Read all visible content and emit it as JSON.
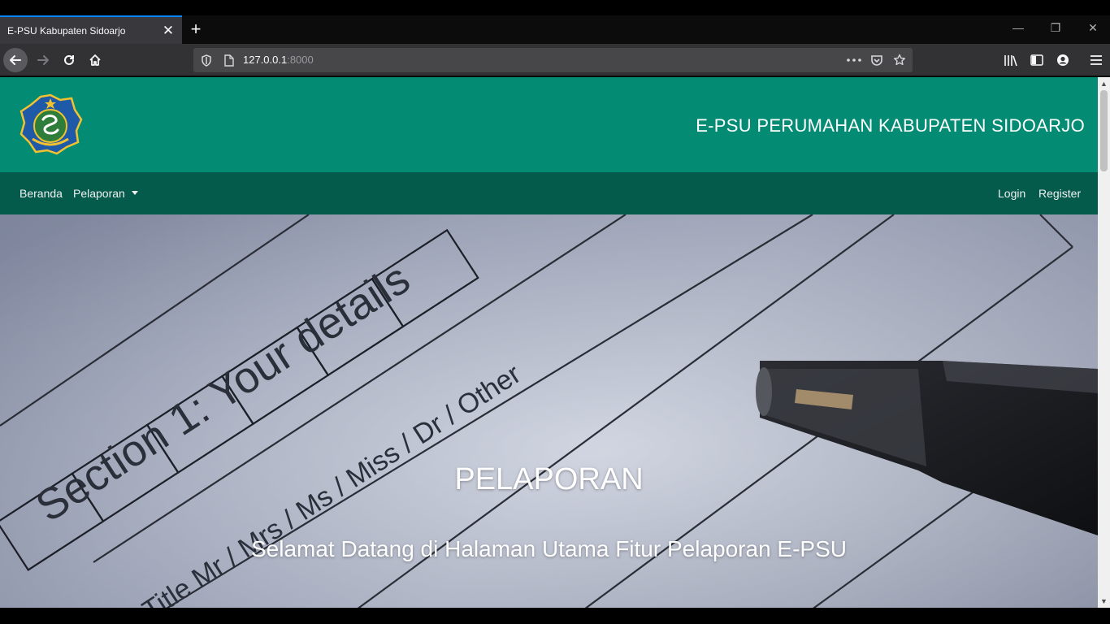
{
  "browser": {
    "tab_title": "E-PSU Kabupaten Sidoarjo",
    "tab_close": "✕",
    "new_tab": "+",
    "url_host": "127.0.0.1",
    "url_port": ":8000",
    "window_controls": {
      "minimize": "—",
      "restore": "❐",
      "close": "✕"
    },
    "icons": [
      "back-icon",
      "forward-icon",
      "reload-icon",
      "home-icon",
      "shield-icon",
      "page-icon",
      "more-icon",
      "pocket-icon",
      "bookmark-star-icon",
      "library-icon",
      "sidebar-icon",
      "account-icon",
      "menu-icon"
    ]
  },
  "header": {
    "site_title": "E-PSU PERUMAHAN KABUPATEN SIDOARJO",
    "logo_icon": "sidoarjo-emblem-icon"
  },
  "nav": {
    "home": "Beranda",
    "report": "Pelaporan",
    "login": "Login",
    "register": "Register"
  },
  "hero": {
    "title": "PELAPORAN",
    "subtitle": "Selamat Datang di Halaman Utama Fitur Pelaporan E-PSU",
    "image_text_heading": "Section 1: Your details",
    "image_text_options": "Title Mr / Mrs / Ms / Miss / Dr / Other"
  },
  "colors": {
    "header_bg": "#048b73",
    "nav_bg": "#045a4b",
    "tab_accent": "#0a84ff"
  }
}
